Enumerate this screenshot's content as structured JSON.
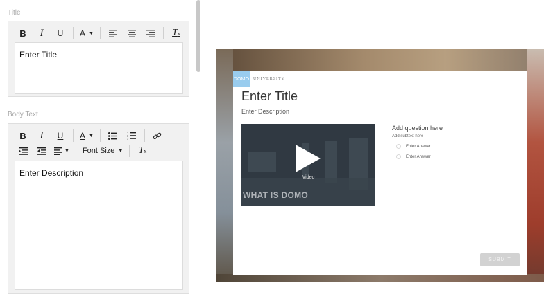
{
  "editor": {
    "title_field": {
      "label": "Title",
      "value": "Enter Title",
      "toolbar": {
        "bold": "B",
        "italic": "I",
        "underline": "U",
        "font_color": "A",
        "clear_format": "T"
      }
    },
    "body_field": {
      "label": "Body Text",
      "value": "Enter Description",
      "toolbar": {
        "bold": "B",
        "italic": "I",
        "underline": "U",
        "font_color": "A",
        "font_size": "Font Size",
        "clear_format": "T"
      }
    }
  },
  "preview": {
    "logo": "DOMO",
    "logo_text": "UNIVERSITY",
    "title": "Enter Title",
    "description": "Enter Description",
    "video": {
      "label": "Video",
      "brand_text": "WHAT IS DOMO"
    },
    "question": "Add question here",
    "subtext": "Add subtext here",
    "answers": [
      "Enter Answer",
      "Enter Answer"
    ],
    "submit_label": "SUBMIT"
  },
  "icons": {
    "align_left": "align-left-icon",
    "align_center": "align-center-icon",
    "align_right": "align-right-icon",
    "bulleted_list": "bulleted-list-icon",
    "numbered_list": "numbered-list-icon",
    "link": "link-icon",
    "indent": "indent-icon",
    "outdent": "outdent-icon",
    "align_dropdown": "align-dropdown-icon",
    "play": "play-icon"
  },
  "colors": {
    "logo_blue": "#99ccee",
    "submit_disabled": "#d2d2d2",
    "panel_gray": "#f1f1f1"
  }
}
